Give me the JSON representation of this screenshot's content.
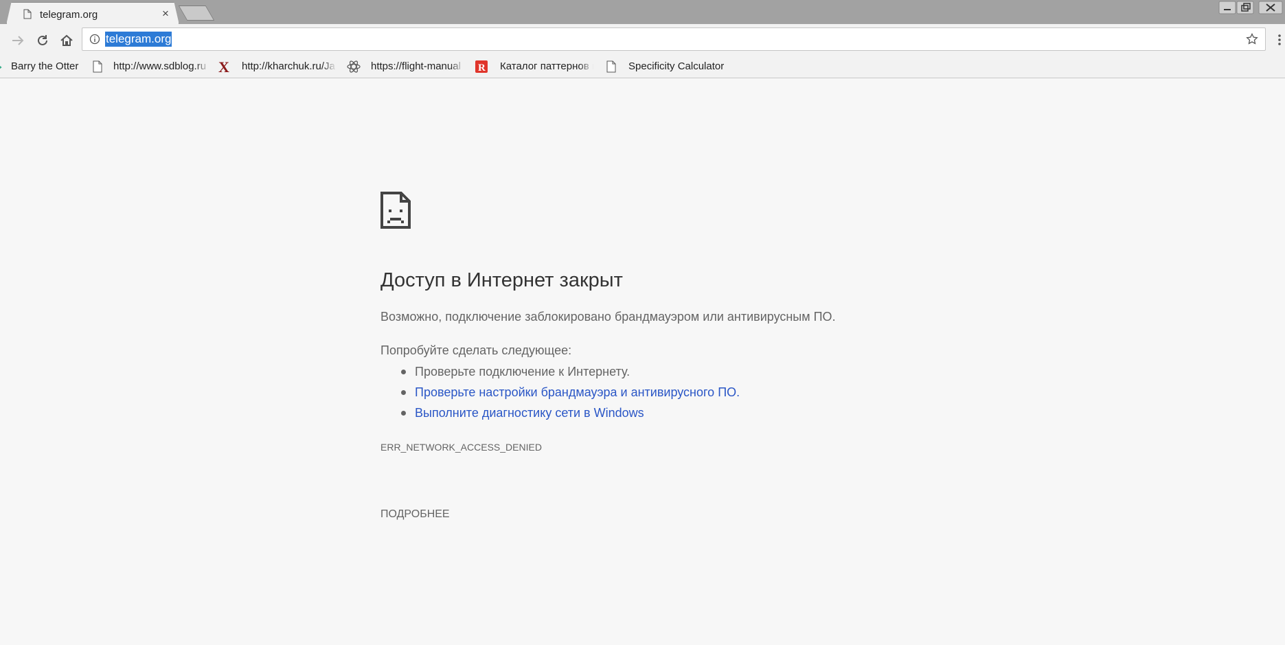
{
  "window": {
    "tab_title": "telegram.org",
    "tab_close": "×"
  },
  "toolbar": {
    "url": "telegram.org"
  },
  "bookmarks": [
    {
      "label": "Barry the Otter",
      "icon": "otter-icon"
    },
    {
      "label": "http://www.sdblog.ru",
      "icon": "page-icon"
    },
    {
      "label": "http://kharchuk.ru/Ja",
      "icon": "x-logo-icon"
    },
    {
      "label": "https://flight-manual",
      "icon": "atom-icon"
    },
    {
      "label": "Каталог паттернов п",
      "icon": "r-logo-icon"
    },
    {
      "label": "Specificity Calculator",
      "icon": "page-icon"
    }
  ],
  "error": {
    "title": "Доступ в Интернет закрыт",
    "description": "Возможно, подключение заблокировано брандмауэром или антивирусным ПО.",
    "try_heading": "Попробуйте сделать следующее:",
    "suggestions": [
      {
        "text": "Проверьте подключение к Интернету.",
        "link": false
      },
      {
        "text": "Проверьте настройки брандмауэра и антивирусного ПО.",
        "link": true
      },
      {
        "text": "Выполните диагностику сети в Windows",
        "link": true
      }
    ],
    "code": "ERR_NETWORK_ACCESS_DENIED",
    "details_button": "ПОДРОБНЕЕ"
  },
  "colors": {
    "link": "#2a56c6",
    "text": "#646464",
    "selection": "#2d7bd6",
    "page_bg": "#f7f7f7"
  }
}
